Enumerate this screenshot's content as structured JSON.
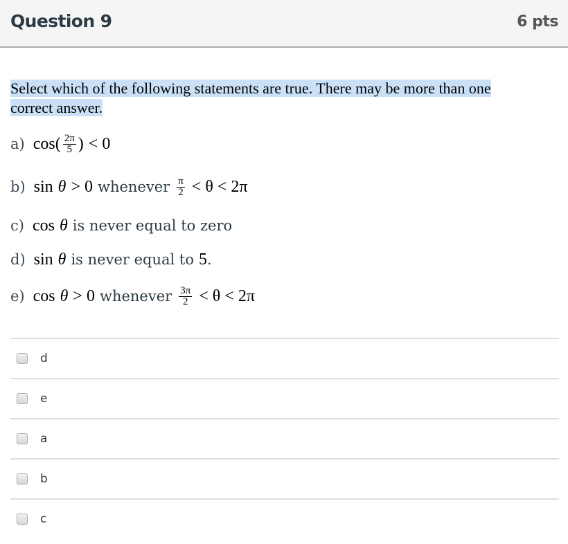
{
  "header": {
    "title": "Question 9",
    "points": "6 pts"
  },
  "prompt": {
    "line1": "Select which of the following statements are true. There may be more than one",
    "line2": "correct answer."
  },
  "statements": [
    {
      "letter": "a)",
      "fn": "cos(",
      "frac_num": "2π",
      "frac_den": "5",
      "close": ")",
      "rel": "< 0"
    },
    {
      "letter": "b)",
      "fn": "sin",
      "var": "θ",
      "rel": "> 0",
      "word": "whenever",
      "frac_num": "π",
      "frac_den": "2",
      "range": "< θ < 2π"
    },
    {
      "letter": "c)",
      "fn": "cos",
      "var": "θ",
      "text": "is never equal to zero"
    },
    {
      "letter": "d)",
      "fn": "sin",
      "var": "θ",
      "text": "is never equal to",
      "value": "5",
      "end": "."
    },
    {
      "letter": "e)",
      "fn": "cos",
      "var": "θ",
      "rel": "> 0",
      "word": "whenever",
      "frac_num": "3π",
      "frac_den": "2",
      "range": "< θ < 2π"
    }
  ],
  "answers": [
    {
      "label": "d",
      "checked": false
    },
    {
      "label": "e",
      "checked": false
    },
    {
      "label": "a",
      "checked": false
    },
    {
      "label": "b",
      "checked": false
    },
    {
      "label": "c",
      "checked": false
    }
  ]
}
